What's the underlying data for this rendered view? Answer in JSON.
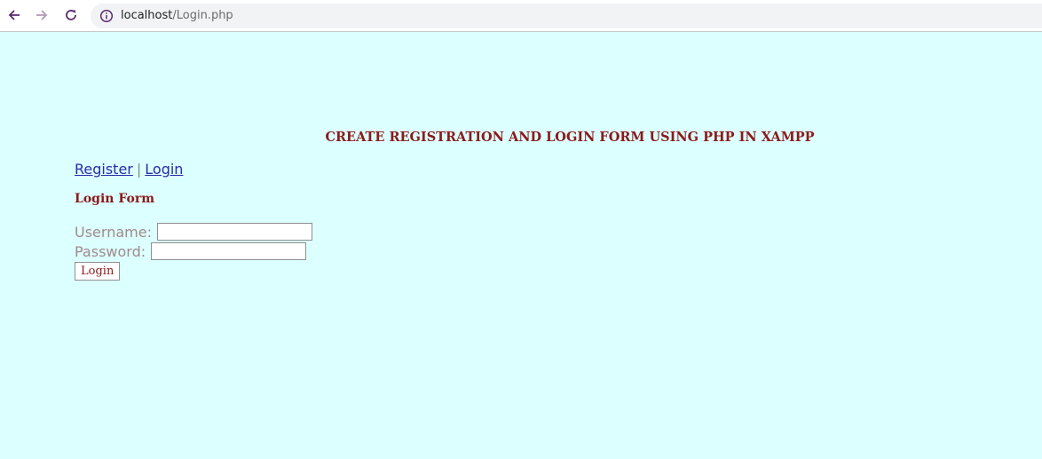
{
  "browser": {
    "url_host": "localhost",
    "url_path": "/Login.php",
    "back_icon": "arrow-left-icon",
    "forward_icon": "arrow-right-icon",
    "reload_icon": "reload-icon",
    "site_info_icon": "info-circle-icon"
  },
  "page": {
    "title": "CREATE REGISTRATION AND LOGIN FORM USING PHP IN XAMPP",
    "links": {
      "register": "Register",
      "separator": "|",
      "login": "Login"
    },
    "form": {
      "title": "Login Form",
      "username_label": "Username:",
      "username_value": "",
      "password_label": "Password:",
      "password_value": "",
      "submit_label": "Login"
    }
  },
  "colors": {
    "background": "#dcffff",
    "heading": "#8b1a1a",
    "link": "#2a2aa8",
    "label": "#a08a8a"
  }
}
